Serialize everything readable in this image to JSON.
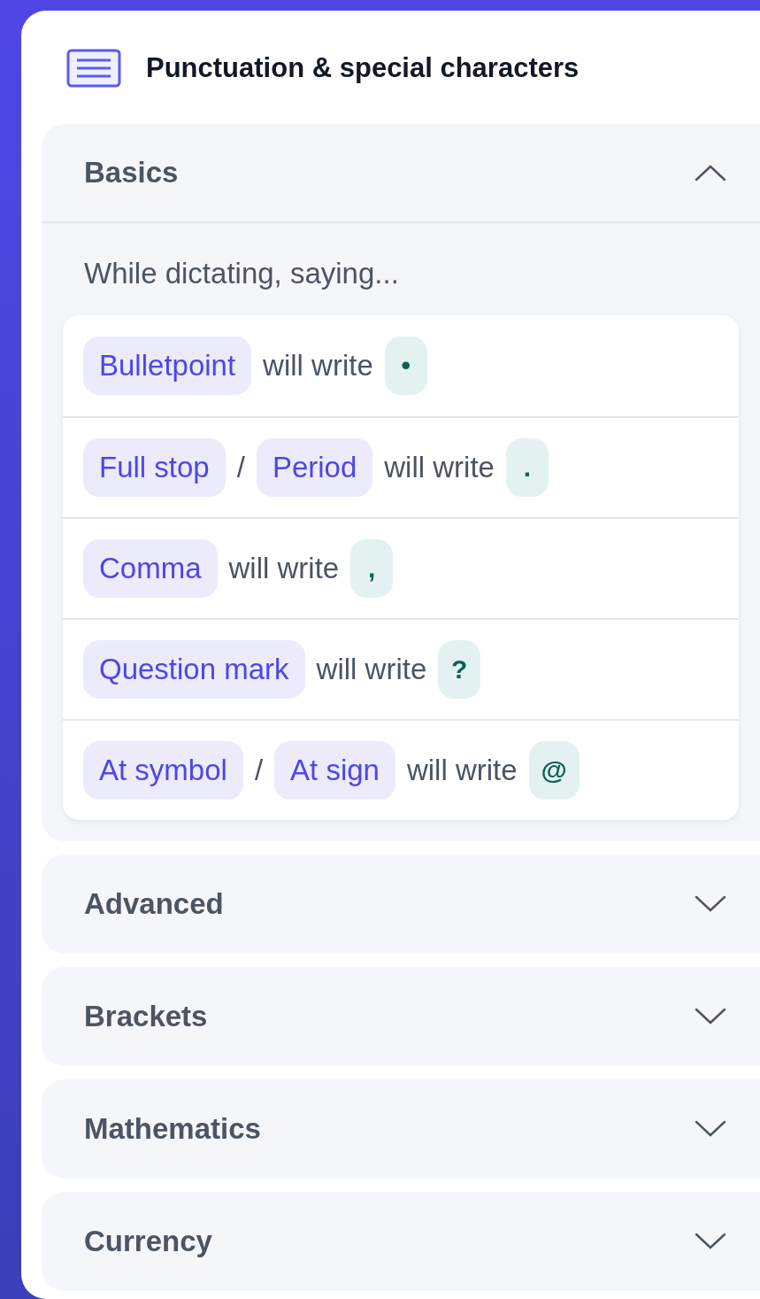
{
  "title": "Punctuation & special characters",
  "sections": [
    {
      "title": "Basics",
      "expanded": true,
      "intro": "While dictating, saying...",
      "rows": [
        {
          "phrases": [
            "Bulletpoint"
          ],
          "verb": "will write",
          "output": "•"
        },
        {
          "phrases": [
            "Full stop",
            "Period"
          ],
          "separator": "/",
          "verb": "will write",
          "output": "."
        },
        {
          "phrases": [
            "Comma"
          ],
          "verb": "will write",
          "output": ","
        },
        {
          "phrases": [
            "Question mark"
          ],
          "verb": "will write",
          "output": "?"
        },
        {
          "phrases": [
            "At symbol",
            "At sign"
          ],
          "separator": "/",
          "verb": "will write",
          "output": "@"
        }
      ]
    },
    {
      "title": "Advanced",
      "expanded": false
    },
    {
      "title": "Brackets",
      "expanded": false
    },
    {
      "title": "Mathematics",
      "expanded": false
    },
    {
      "title": "Currency",
      "expanded": false
    }
  ]
}
